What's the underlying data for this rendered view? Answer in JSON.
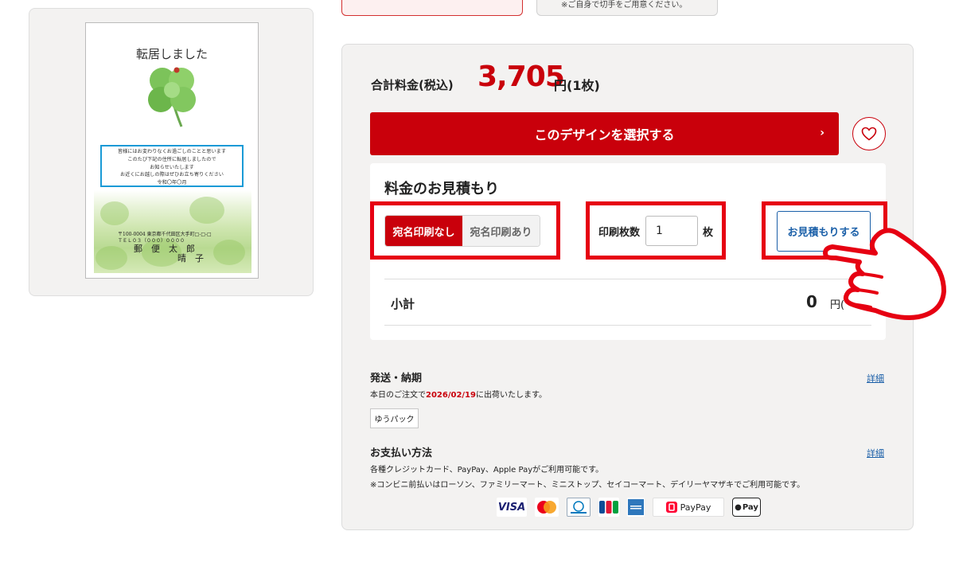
{
  "postcard": {
    "title": "転居しました",
    "message_lines": [
      "皆様にはお変わりなくお過ごしのことと思います",
      "このたび下記の住所に転居しましたので",
      "お知らせいたします",
      "お近くにお越しの際はぜひお立ち寄りください",
      "令和〇年〇月"
    ],
    "address_lines": [
      "〒100-0004 東京都千代田区大手町□-□-□",
      "ＴＥＬ０３（０００）００００"
    ],
    "name": "郵　便　太　郎\n　　　　　晴　子"
  },
  "top_note": "※ご自身で切手をご用意ください。",
  "price": {
    "label": "合計料金(税込)",
    "amount": "3,705",
    "unit": "円(1枚)"
  },
  "select_button": "このデザインを選択する",
  "estimate": {
    "title": "料金のお見積もり",
    "toggle_on": "宛名印刷なし",
    "toggle_off": "宛名印刷あり",
    "qty_label": "印刷枚数",
    "qty_value": "1",
    "qty_unit": "枚",
    "button": "お見積もりする",
    "subtotal_label": "小計",
    "subtotal_value": "0",
    "subtotal_unit": "円("
  },
  "shipping": {
    "title": "発送・納期",
    "text_prefix": "本日のご注文で",
    "date": "2026/02/19",
    "text_suffix": "に出荷いたします。",
    "carrier": "ゆうパック",
    "detail_link": "詳細"
  },
  "payment": {
    "title": "お支払い方法",
    "line1": "各種クレジットカード、PayPay、Apple Payがご利用可能です。",
    "line2": "※コンビニ前払いはローソン、ファミリーマート、ミニストップ、セイコーマート、デイリーヤマザキでご利用可能です。",
    "detail_link": "詳細",
    "methods": [
      "VISA",
      "PayPay",
      "Pay"
    ]
  },
  "colors": {
    "brand_red": "#c9000b",
    "link_blue": "#1a5fa8",
    "highlight_red": "#e60012"
  }
}
